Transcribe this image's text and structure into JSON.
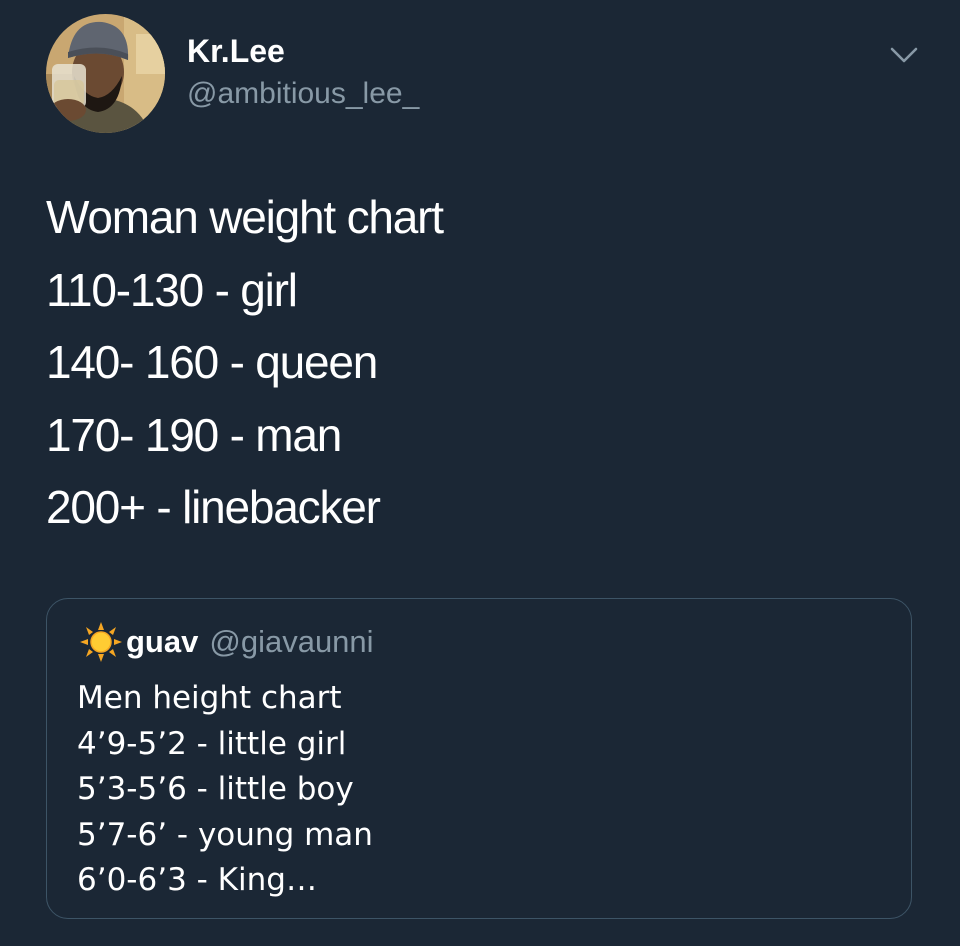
{
  "tweet": {
    "author": {
      "display_name": "Kr.Lee",
      "handle": "@ambitious_lee_"
    },
    "text_lines": [
      "Woman weight chart",
      "110-130 - girl",
      "140- 160 - queen",
      "170- 190 - man",
      "200+ - linebacker"
    ],
    "more_icon": "chevron-down-icon"
  },
  "quoted_tweet": {
    "icon": "sun-emoji",
    "display_name": "guav",
    "handle": "@giavaunni",
    "text_lines": [
      "Men height chart",
      "4’9-5’2 - little girl",
      "5’3-5’6 - little boy",
      "5’7-6’ - young man",
      "6’0-6’3 - King…"
    ]
  },
  "colors": {
    "background": "#1b2735",
    "text": "#ffffff",
    "secondary_text": "#8899a6",
    "card_border": "#3d5466"
  }
}
